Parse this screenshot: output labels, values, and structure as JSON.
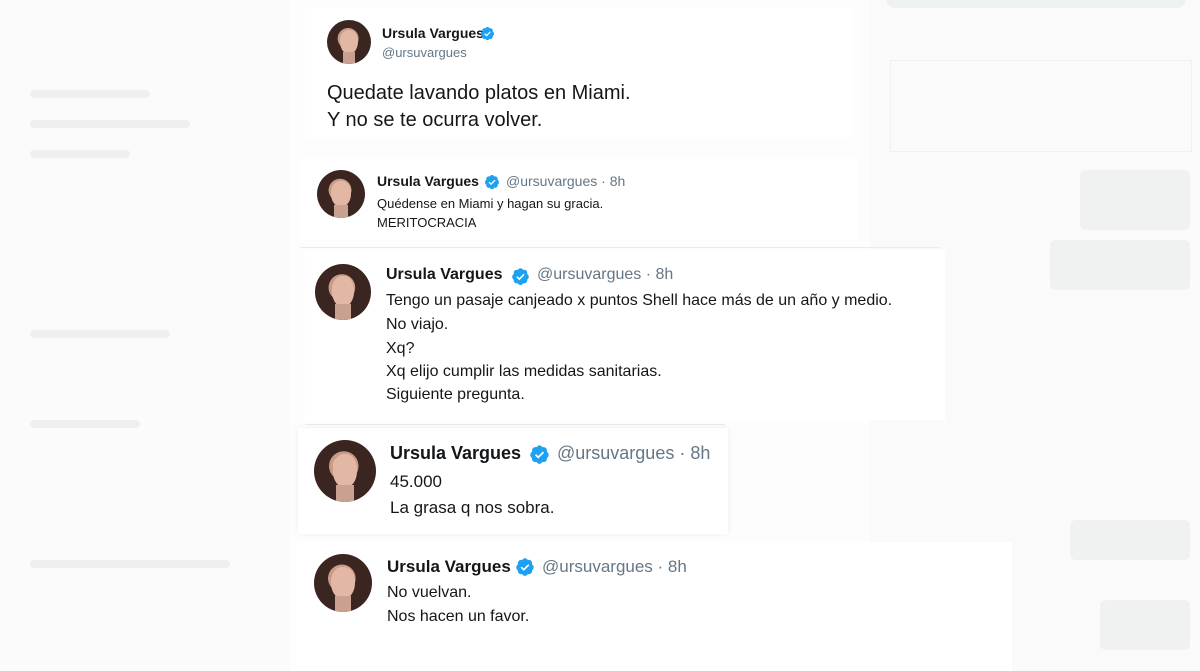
{
  "tweets": [
    {
      "name": "Ursula Vargues",
      "handle": "@ursuvargues",
      "time": "",
      "lines": [
        "Quedate lavando platos en Miami.",
        "Y no se te ocurra volver."
      ]
    },
    {
      "name": "Ursula Vargues",
      "handle": "@ursuvargues · 8h",
      "lines": [
        "Quédense en Miami y hagan su gracia.",
        "MERITOCRACIA"
      ]
    },
    {
      "name": "Ursula Vargues",
      "handle": "@ursuvargues · 8h",
      "lines": [
        "Tengo un pasaje canjeado x puntos Shell hace más de un año y medio.",
        "No viajo.",
        "Xq?",
        "Xq elijo cumplir las medidas sanitarias.",
        "Siguiente pregunta."
      ]
    },
    {
      "name": "Ursula Vargues",
      "handle": "@ursuvargues · 8h",
      "lines": [
        "45.000",
        "La grasa q nos sobra."
      ]
    },
    {
      "name": "Ursula Vargues",
      "handle": "@ursuvargues · 8h",
      "lines": [
        "No vuelvan.",
        "Nos hacen un favor."
      ]
    }
  ],
  "colors": {
    "verified": "#1da1f2",
    "name": "#14171a",
    "handle": "#657786"
  },
  "icons": {
    "verified": "verified-badge-icon"
  }
}
